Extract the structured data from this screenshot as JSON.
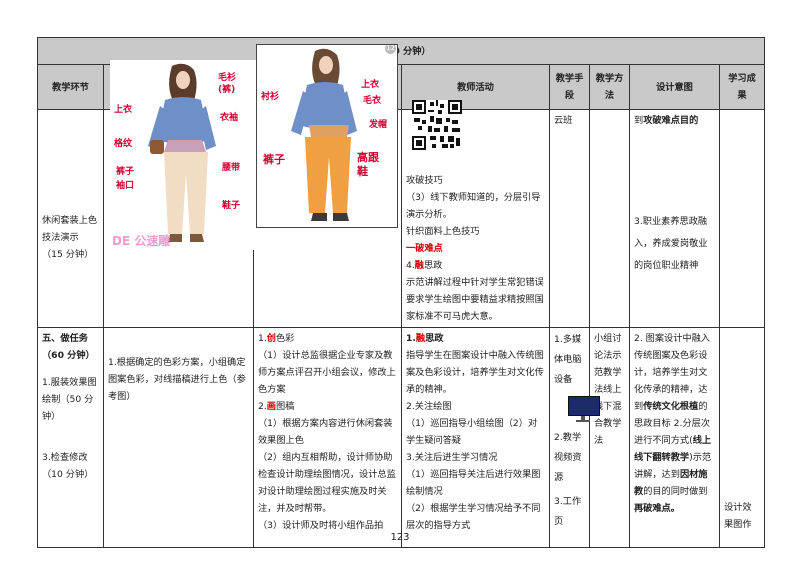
{
  "header": {
    "title": "（180 分钟）"
  },
  "columns": [
    "教学环节",
    "教师活动",
    "教学手段",
    "教学方法",
    "设计意图",
    "学习成果"
  ],
  "row1": {
    "stage": "休闲套装上色技法演示（15 分钟）",
    "teacher": [
      "攻破技巧",
      "（3）线下教师知道的，分层引导演示分析。",
      "针织面料上色技巧",
      "一破难点",
      "4.",
      "融",
      "思政",
      "示范讲解过程中针对学生常犯错误要求学生绘图中要精益求精按照国家标准不可马虎大意。"
    ],
    "means": "云班",
    "intent": [
      "到",
      "攻破难点目的",
      "3.职业素养思政融入，养成爱岗敬业的岗位职业精神"
    ]
  },
  "row2": {
    "stage": [
      "五、做任务（60 分钟）",
      "1.服装效果图绘制（50 分钟）",
      "3.检查修改（10 分钟）"
    ],
    "task": "1.根据确定的色彩方案，小组确定图案色彩，对线描稿进行上色（参考图）",
    "student": [
      "1.",
      "创",
      "色彩",
      "（1）设计总监很据企业专家及教师方案点评召开小组会议，修改上色方案",
      "2.",
      "画",
      "图稿",
      "（1）根据方案内容进行休闲套装效果图上色",
      "（2）组内互相帮助，设计师协助检查设计助理绘图情况，设计总监对设计助理绘图过程实施及时关注，并及时帮带。",
      "（3）设计师及时将小组作品拍"
    ],
    "teacher": [
      "1.",
      "融",
      "思政",
      "指导学生在图案设计中融入传统图案及色彩设计，培养学生对文化传承的精神。",
      "2.关注绘图",
      "（1）巡回指导小组绘图（2）对学生疑问答疑",
      "3.关注后进生学习情况",
      "（1）巡回指导关注后进行效果图绘制情况",
      "（2）根据学生学习情况给予不同层次的指导方式"
    ],
    "means": [
      "1.多媒体电脑设备",
      "2.教学视频资源",
      "3.工作页"
    ],
    "method": "小组讨论法示范教学法线上线下混合教学法",
    "intent": [
      "2. 图案设计中融入传统图案及色彩设计，培养学生对文化传承的精神，达到",
      "传统文化根植",
      "的思政目标",
      "2.分层次进行不同方式(",
      "线上线下翻转教学",
      ")示范讲解，达到",
      "因材施教",
      "的目的同时做到",
      "再破难点。"
    ],
    "result": "设计效果图作"
  },
  "figure_left": {
    "labels": [
      "毛衫",
      "上衣",
      "衣袖",
      "格纹",
      "(裤)",
      "腰带",
      "裤子",
      "袖口",
      "鞋子"
    ],
    "watermark": "DE 公速雕"
  },
  "figure_right": {
    "labels": [
      "衬衫",
      "上衣",
      "毛衣",
      "发帽",
      "裤子",
      "高跟",
      "鞋"
    ],
    "badge": "12"
  },
  "page": {
    "number": "123"
  },
  "colors": {
    "header_bg": "#c9c9c9",
    "accent_red": "#d40000",
    "border": "#333333"
  }
}
